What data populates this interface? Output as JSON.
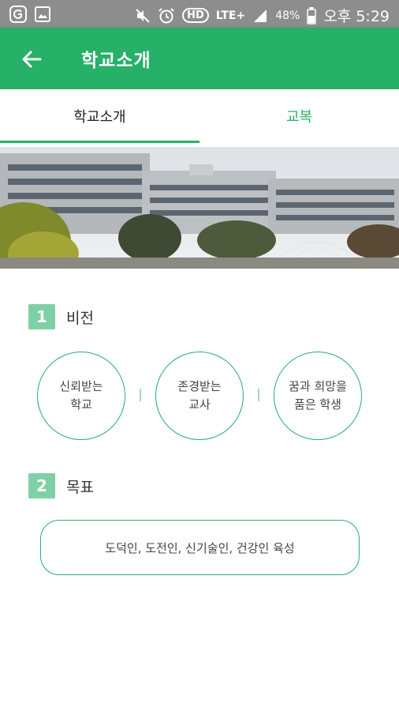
{
  "status_bar": {
    "battery_percent": "48%",
    "network": "LTE+",
    "hd": "HD",
    "time": "오후 5:29",
    "icons": [
      "g-app-icon",
      "gallery-icon",
      "mute-icon",
      "alarm-icon",
      "signal-icon",
      "battery-icon"
    ]
  },
  "app_bar": {
    "title": "학교소개",
    "back_icon": "arrow-left-icon"
  },
  "tabs": [
    {
      "label": "학교소개",
      "active": true
    },
    {
      "label": "교복",
      "active": false
    }
  ],
  "sections": {
    "vision": {
      "number": "1",
      "title": "비전",
      "items": [
        {
          "line1": "신뢰받는",
          "line2": "학교"
        },
        {
          "line1": "존경받는",
          "line2": "교사"
        },
        {
          "line1": "꿈과 희망을",
          "line2": "품은 학생"
        }
      ]
    },
    "goal": {
      "number": "2",
      "title": "목표",
      "text": "도덕인, 도전인, 신기술인, 건강인 육성"
    }
  },
  "colors": {
    "accent": "#27b067",
    "badge": "#7fd0a6",
    "status_bar": "#8d8d8d"
  }
}
